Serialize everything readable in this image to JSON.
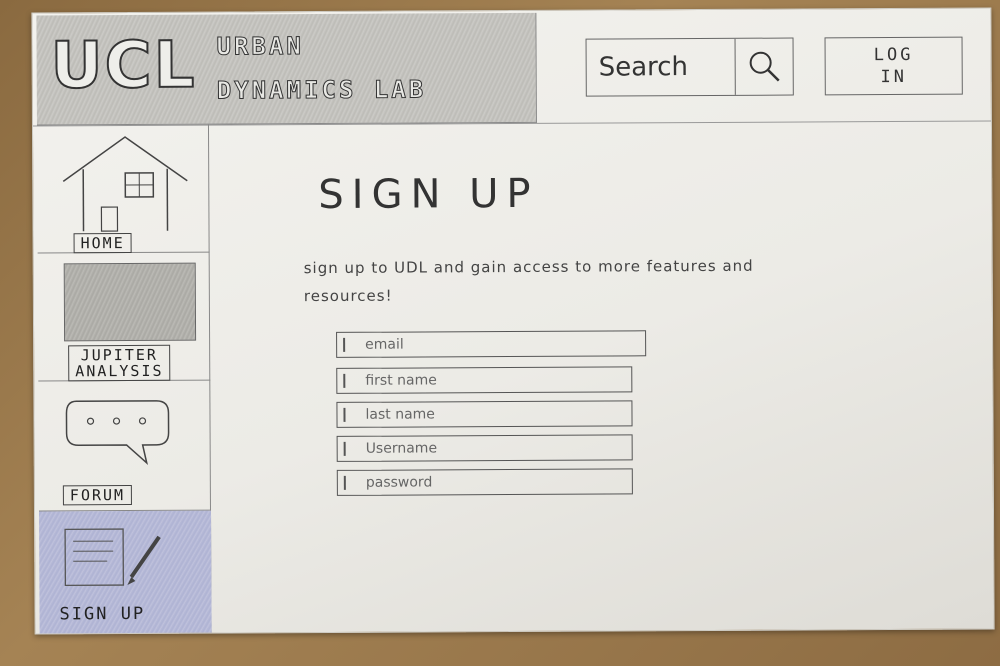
{
  "header": {
    "logo": "UCL",
    "lab_name_line1": "URBAN",
    "lab_name_line2": "DYNAMICS LAB",
    "search_label": "Search",
    "search_icon": "search-icon",
    "login_line1": "LOG",
    "login_line2": "IN"
  },
  "sidebar": {
    "items": [
      {
        "label": "HOME",
        "icon": "house-icon"
      },
      {
        "label_line1": "JUPITER",
        "label_line2": "ANALYSIS",
        "icon": "image-placeholder"
      },
      {
        "label": "FORUM",
        "icon": "speech-bubble-icon"
      },
      {
        "label": "SIGN UP",
        "icon": "notepad-pen-icon",
        "active": true
      }
    ]
  },
  "main": {
    "title": "SIGN UP",
    "intro": "sign up to UDL and gain access to more features and resources!",
    "fields": [
      {
        "placeholder": "email"
      },
      {
        "placeholder": "first name"
      },
      {
        "placeholder": "last name"
      },
      {
        "placeholder": "Username"
      },
      {
        "placeholder": "password"
      }
    ]
  },
  "colors": {
    "background_wood": "#a58354",
    "paper": "#f0efeb",
    "active_nav": "#b4b8d6",
    "ink": "#333333"
  }
}
